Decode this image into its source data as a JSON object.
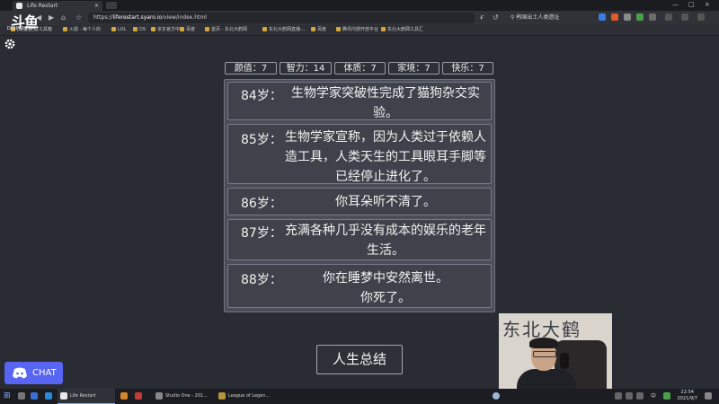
{
  "browser": {
    "tab_title": "Life Restart",
    "close_glyph": "×",
    "url_prefix": "https://",
    "url_host": "liferestart.syaro.io",
    "url_path": "/view/index.html",
    "search_text": "韩国出土人类遗址",
    "window_min": "—",
    "window_max": "□",
    "window_close": "×"
  },
  "bookmarks": [
    "[配置]汇总工具箱",
    "火狐 - 每个人的",
    "LOL",
    "DS",
    "京东官方中心",
    "百度",
    "首页 - 东北大鹤网",
    "东北大鹤网直播-...",
    "百度",
    "腾讯内部开放平台",
    "东北大鹤网工具汇"
  ],
  "overlay": {
    "watermark": "斗鱼",
    "watermark_sub": "DOUYU.COM"
  },
  "stats": [
    {
      "label": "颜值",
      "value": "7"
    },
    {
      "label": "智力",
      "value": "14"
    },
    {
      "label": "体质",
      "value": "7"
    },
    {
      "label": "家境",
      "value": "7"
    },
    {
      "label": "快乐",
      "value": "7"
    }
  ],
  "events": [
    {
      "age": "84岁：",
      "line1": "生物学家突破性完成了猫狗杂交实",
      "line2": "验。"
    },
    {
      "age": "85岁：",
      "line1": "生物学家宣称，因为人类过于依赖人",
      "line2": "造工具，人类天生的工具眼耳手脚等",
      "line3": "已经停止进化了。"
    },
    {
      "age": "86岁：",
      "line1": "你耳朵听不清了。"
    },
    {
      "age": "87岁：",
      "line1": "充满各种几乎没有成本的娱乐的老年",
      "line2": "生活。"
    },
    {
      "age": "88岁：",
      "line1": "你在睡梦中安然离世。",
      "line2": "你死了。"
    }
  ],
  "summary_button": "人生总结",
  "chat_button": "CHAT",
  "webcam_text": "东北大鹤",
  "taskbar": {
    "items": [
      "Life Restart",
      "Studio One - 201...",
      "League of Legen..."
    ],
    "time": "22:54",
    "date": "2021/9/7",
    "ime": "中"
  },
  "colors": {
    "discord": "#5865f2",
    "background": "#2a2c33",
    "panel": "#4b4e58"
  }
}
